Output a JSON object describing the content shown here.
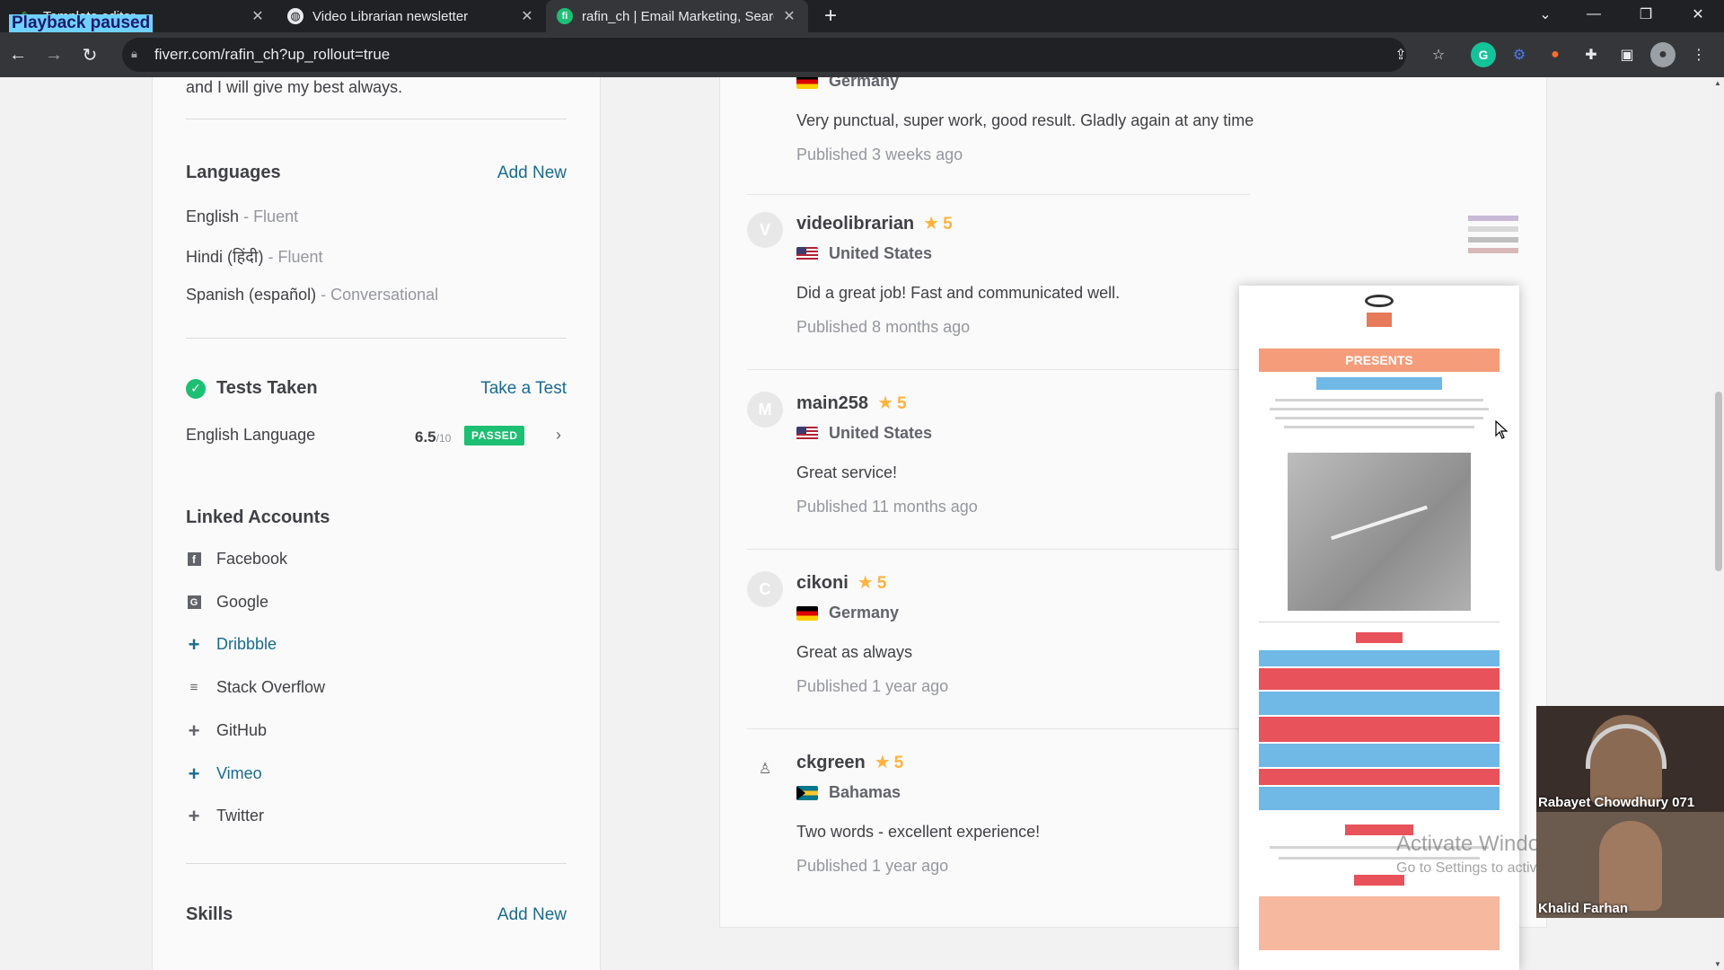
{
  "overlay": {
    "playback": "Playback paused"
  },
  "browser": {
    "tabs": [
      {
        "title": "Template editor",
        "icon": "template-icon"
      },
      {
        "title": "Video Librarian newsletter",
        "icon": "globe-icon"
      },
      {
        "title": "rafin_ch | Email Marketing, Searc",
        "icon": "fiverr-icon",
        "active": true
      }
    ],
    "url": "fiverr.com/rafin_ch?up_rollout=true"
  },
  "left": {
    "intro": "and I will give my best always.",
    "languages": {
      "title": "Languages",
      "add": "Add New",
      "items": [
        {
          "name": "English",
          "level": "Fluent"
        },
        {
          "name": "Hindi (हिंदी)",
          "level": "Fluent"
        },
        {
          "name": "Spanish (español)",
          "level": "Conversational"
        }
      ]
    },
    "tests": {
      "title": "Tests Taken",
      "action": "Take a Test",
      "item": {
        "name": "English Language",
        "score": "6.5",
        "out_of": "/10",
        "badge": "PASSED"
      }
    },
    "linked": {
      "title": "Linked Accounts",
      "items": [
        {
          "label": "Facebook",
          "icon": "facebook-icon",
          "linked": true
        },
        {
          "label": "Google",
          "icon": "google-icon",
          "linked": true
        },
        {
          "label": "Dribbble",
          "icon": "plus-icon",
          "linked": false
        },
        {
          "label": "Stack Overflow",
          "icon": "stackoverflow-icon",
          "linked": true
        },
        {
          "label": "GitHub",
          "icon": "plus-icon",
          "linked": false
        },
        {
          "label": "Vimeo",
          "icon": "plus-icon",
          "linked": false
        },
        {
          "label": "Twitter",
          "icon": "plus-icon",
          "linked": false
        }
      ]
    },
    "skills": {
      "title": "Skills",
      "add": "Add New"
    }
  },
  "reviews": [
    {
      "name": "",
      "rating": "",
      "country": "Germany",
      "text": "Very punctual, super work, good result. Gladly again at any time",
      "published": "Published 3 weeks ago",
      "avatar": ""
    },
    {
      "name": "videolibrarian",
      "rating": "5",
      "country": "United States",
      "text": "Did a great job! Fast and communicated well.",
      "published": "Published 8 months ago",
      "avatar": "V"
    },
    {
      "name": "main258",
      "rating": "5",
      "country": "United States",
      "text": "Great service!",
      "published": "Published 11 months ago",
      "avatar": "M"
    },
    {
      "name": "cikoni",
      "rating": "5",
      "country": "Germany",
      "text": "Great as always",
      "published": "Published 1 year ago",
      "avatar": "C"
    },
    {
      "name": "ckgreen",
      "rating": "5",
      "country": "Bahamas",
      "text": "Two words - excellent experience!",
      "published": "Published 1 year ago",
      "avatar": ""
    }
  ],
  "preview": {
    "heading": "PRESENTS"
  },
  "webcams": [
    {
      "name": "Rabayet Chowdhury 071"
    },
    {
      "name": "Khalid Farhan"
    }
  ],
  "watermark": {
    "title": "Activate Windows",
    "subtitle": "Go to Settings to activate Windows."
  },
  "colors": {
    "accent_green": "#1dbf73",
    "star": "#ffb33e",
    "link": "#1a6b8f"
  }
}
